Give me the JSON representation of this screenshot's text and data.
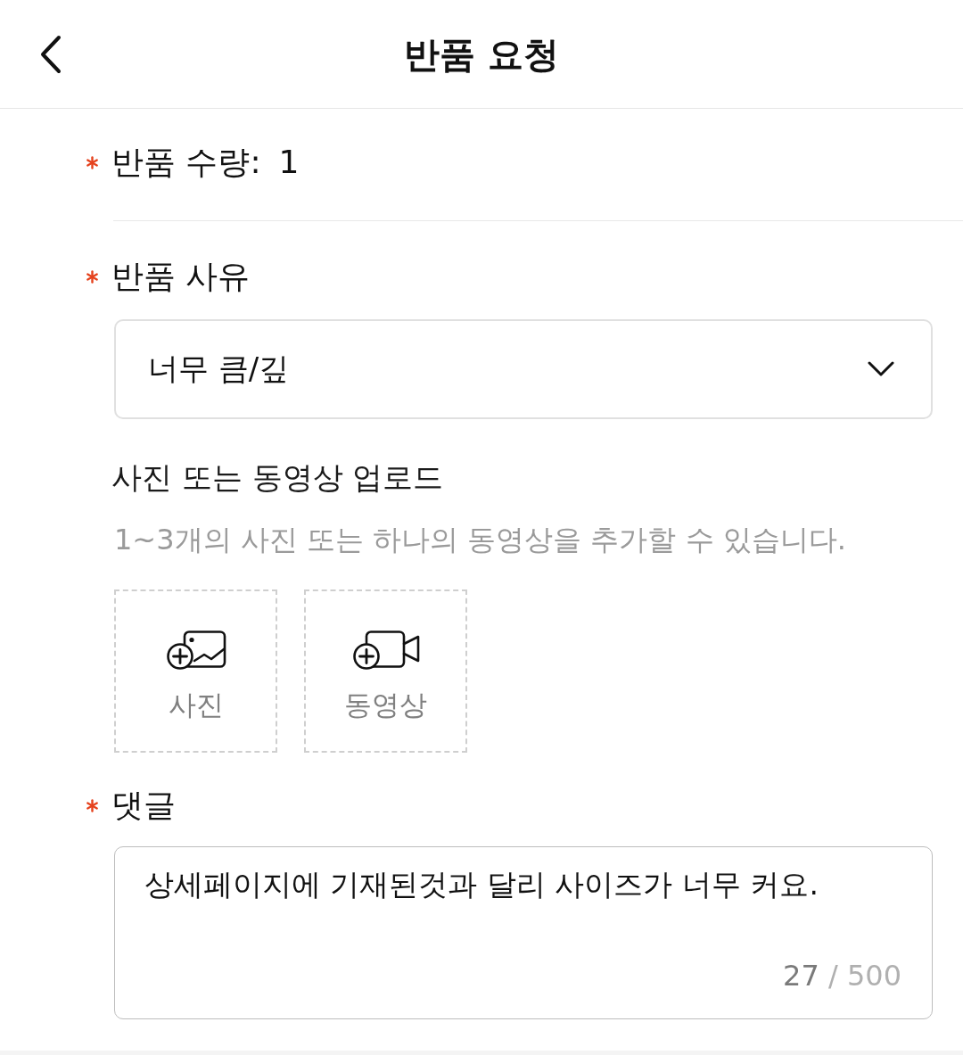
{
  "header": {
    "title": "반품 요청"
  },
  "quantity": {
    "required": true,
    "label": "반품 수량:",
    "value": "1"
  },
  "reason": {
    "required": true,
    "label": "반품 사유",
    "select": {
      "value": "너무 큼/깊"
    }
  },
  "upload": {
    "title": "사진 또는 동영상 업로드",
    "hint": "1~3개의 사진 또는 하나의 동영상을 추가할 수 있습니다.",
    "tiles": [
      {
        "kind": "photo",
        "label": "사진"
      },
      {
        "kind": "video",
        "label": "동영상"
      }
    ]
  },
  "comment": {
    "required": true,
    "label": "댓글",
    "value": "상세페이지에 기재된것과 달리 사이즈가 너무 커요.",
    "count": "27",
    "limit": "/ 500"
  }
}
